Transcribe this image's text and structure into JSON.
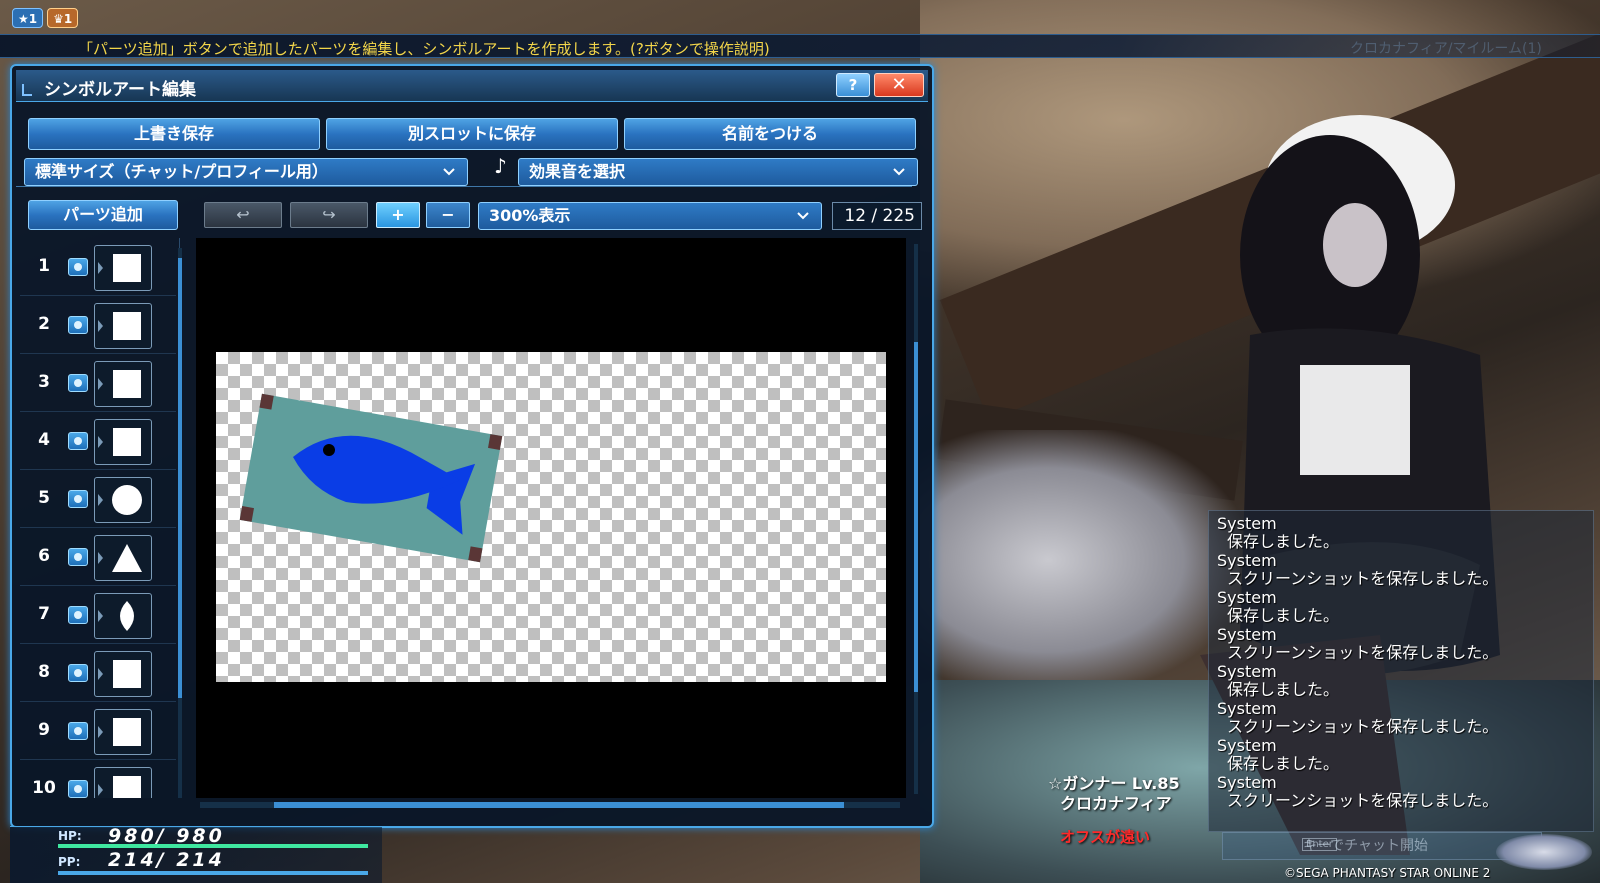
{
  "badges": [
    "1",
    "1"
  ],
  "hint": {
    "text": "「パーツ追加」ボタンで追加したパーツを編集し、シンボルアートを作成します。(?ボタンで操作説明)",
    "right_text": "クロカナフィア/マイルーム(1)"
  },
  "window": {
    "title": "シンボルアート編集",
    "help_label": "?",
    "close_label": "✕"
  },
  "toolbar": {
    "overwrite_save": "上書き保存",
    "save_other_slot": "別スロットに保存",
    "name_button": "名前をつける",
    "size_select": "標準サイズ（チャット/プロフィール用）",
    "sound_icon": "♪",
    "sound_select": "効果音を選択",
    "add_parts": "パーツ追加",
    "undo": "↩",
    "redo": "↪",
    "zoom_in": "+",
    "zoom_out": "−",
    "zoom_select": "300%表示",
    "counter": "12 / 225"
  },
  "parts": [
    {
      "num": "1",
      "shape": "square"
    },
    {
      "num": "2",
      "shape": "square"
    },
    {
      "num": "3",
      "shape": "square"
    },
    {
      "num": "4",
      "shape": "square"
    },
    {
      "num": "5",
      "shape": "circle"
    },
    {
      "num": "6",
      "shape": "triangle"
    },
    {
      "num": "7",
      "shape": "leaf"
    },
    {
      "num": "8",
      "shape": "square"
    },
    {
      "num": "9",
      "shape": "square"
    },
    {
      "num": "10",
      "shape": "square"
    }
  ],
  "canvas": {
    "plate_color": "#5f9e9c",
    "fish_color": "#0a3de6",
    "corner_color": "#5a3636"
  },
  "status": {
    "hp_label": "HP:",
    "hp_value": "980/ 980",
    "pp_label": "PP:",
    "pp_value": "214/ 214"
  },
  "chat": {
    "entries": [
      {
        "sender": "System",
        "message": "保存しました。"
      },
      {
        "sender": "System",
        "message": "スクリーンショットを保存しました。"
      },
      {
        "sender": "System",
        "message": "保存しました。"
      },
      {
        "sender": "System",
        "message": "スクリーンショットを保存しました。"
      },
      {
        "sender": "System",
        "message": "保存しました。"
      },
      {
        "sender": "System",
        "message": "スクリーンショットを保存しました。"
      },
      {
        "sender": "System",
        "message": "保存しました。"
      },
      {
        "sender": "System",
        "message": "スクリーンショットを保存しました。"
      }
    ],
    "input_key": "Enter",
    "input_placeholder": "キーでチャット開始"
  },
  "player": {
    "class_level": "ガンナー Lv.85",
    "name": "クロカナフィア",
    "status": "オフスが遠い"
  },
  "copyright": "©SEGA PHANTASY STAR ONLINE 2"
}
